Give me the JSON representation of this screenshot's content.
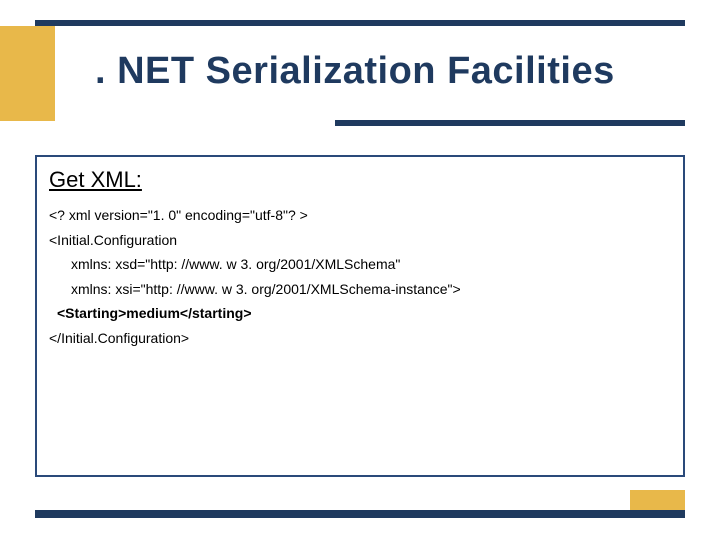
{
  "title": ". NET Serialization Facilities",
  "section_title": "Get XML:",
  "code": {
    "l1": "<? xml version=\"1. 0\" encoding=\"utf-8\"? >",
    "l2": "<Initial.Configuration",
    "l3": "xmlns: xsd=\"http: //www. w 3. org/2001/XMLSchema\"",
    "l4": "xmlns: xsi=\"http: //www. w 3. org/2001/XMLSchema-instance\">",
    "l5": "<Starting>medium</starting>",
    "l6": "</Initial.Configuration>"
  }
}
